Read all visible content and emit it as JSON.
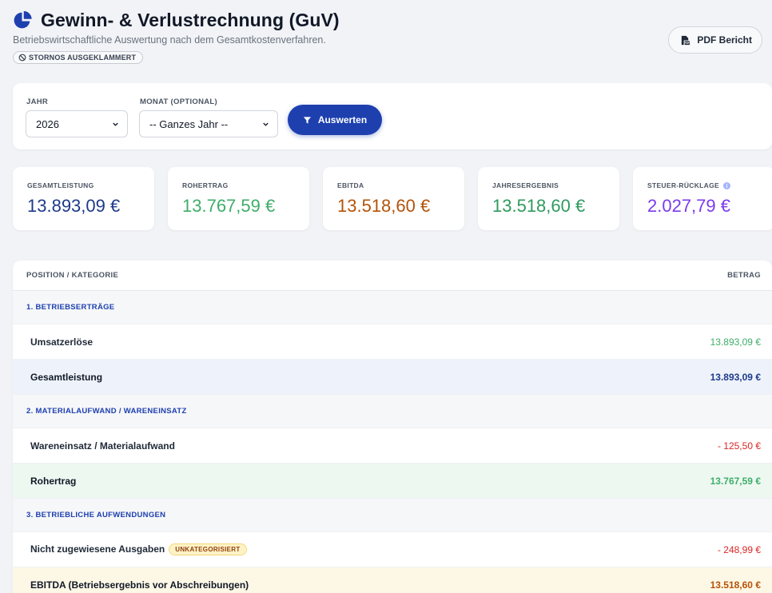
{
  "header": {
    "title": "Gewinn- & Verlustrechnung (GuV)",
    "subtitle": "Betriebswirtschaftliche Auswertung nach dem Gesamtkostenverfahren.",
    "badge": "STORNOS AUSGEKLAMMERT",
    "pdf_button": "PDF Bericht"
  },
  "filters": {
    "year_label": "JAHR",
    "year_value": "2026",
    "month_label": "MONAT (OPTIONAL)",
    "month_value": "-- Ganzes Jahr --",
    "apply_button": "Auswerten"
  },
  "kpis": [
    {
      "label": "GESAMTLEISTUNG",
      "value": "13.893,09 €",
      "color": "#1e3a8a"
    },
    {
      "label": "ROHERTRAG",
      "value": "13.767,59 €",
      "color": "#3fae6a"
    },
    {
      "label": "EBITDA",
      "value": "13.518,60 €",
      "color": "#b45309"
    },
    {
      "label": "JAHRESERGEBNIS",
      "value": "13.518,60 €",
      "color": "#2f9a5e"
    },
    {
      "label": "STEUER-RÜCKLAGE",
      "value": "2.027,79 €",
      "color": "#7c3aed",
      "icon": "info-icon"
    }
  ],
  "table": {
    "col_position": "POSITION / KATEGORIE",
    "col_amount": "BETRAG",
    "rows": [
      {
        "type": "section",
        "label": "1. BETRIEBSERTRÄGE"
      },
      {
        "type": "item",
        "label": "Umsatzerlöse",
        "amount": "13.893,09 €",
        "color": "#3fae6a"
      },
      {
        "type": "total-blue",
        "label": "Gesamtleistung",
        "amount": "13.893,09 €",
        "color": "#1e3a8a"
      },
      {
        "type": "section",
        "label": "2. MATERIALAUFWAND / WARENEINSATZ"
      },
      {
        "type": "item",
        "label": "Wareneinsatz / Materialaufwand",
        "amount": "- 125,50 €",
        "color": "#dc2626"
      },
      {
        "type": "total-green",
        "label": "Rohertrag",
        "amount": "13.767,59 €",
        "color": "#3fae6a"
      },
      {
        "type": "section",
        "label": "3. BETRIEBLICHE AUFWENDUNGEN"
      },
      {
        "type": "item",
        "label": "Nicht zugewiesene Ausgaben",
        "badge": "UNKATEGORISIERT",
        "amount": "- 248,99 €",
        "color": "#dc2626"
      },
      {
        "type": "total-yellow",
        "label": "EBITDA (Betriebsergebnis vor Abschreibungen)",
        "amount": "13.518,60 €",
        "color": "#b45309"
      }
    ]
  }
}
